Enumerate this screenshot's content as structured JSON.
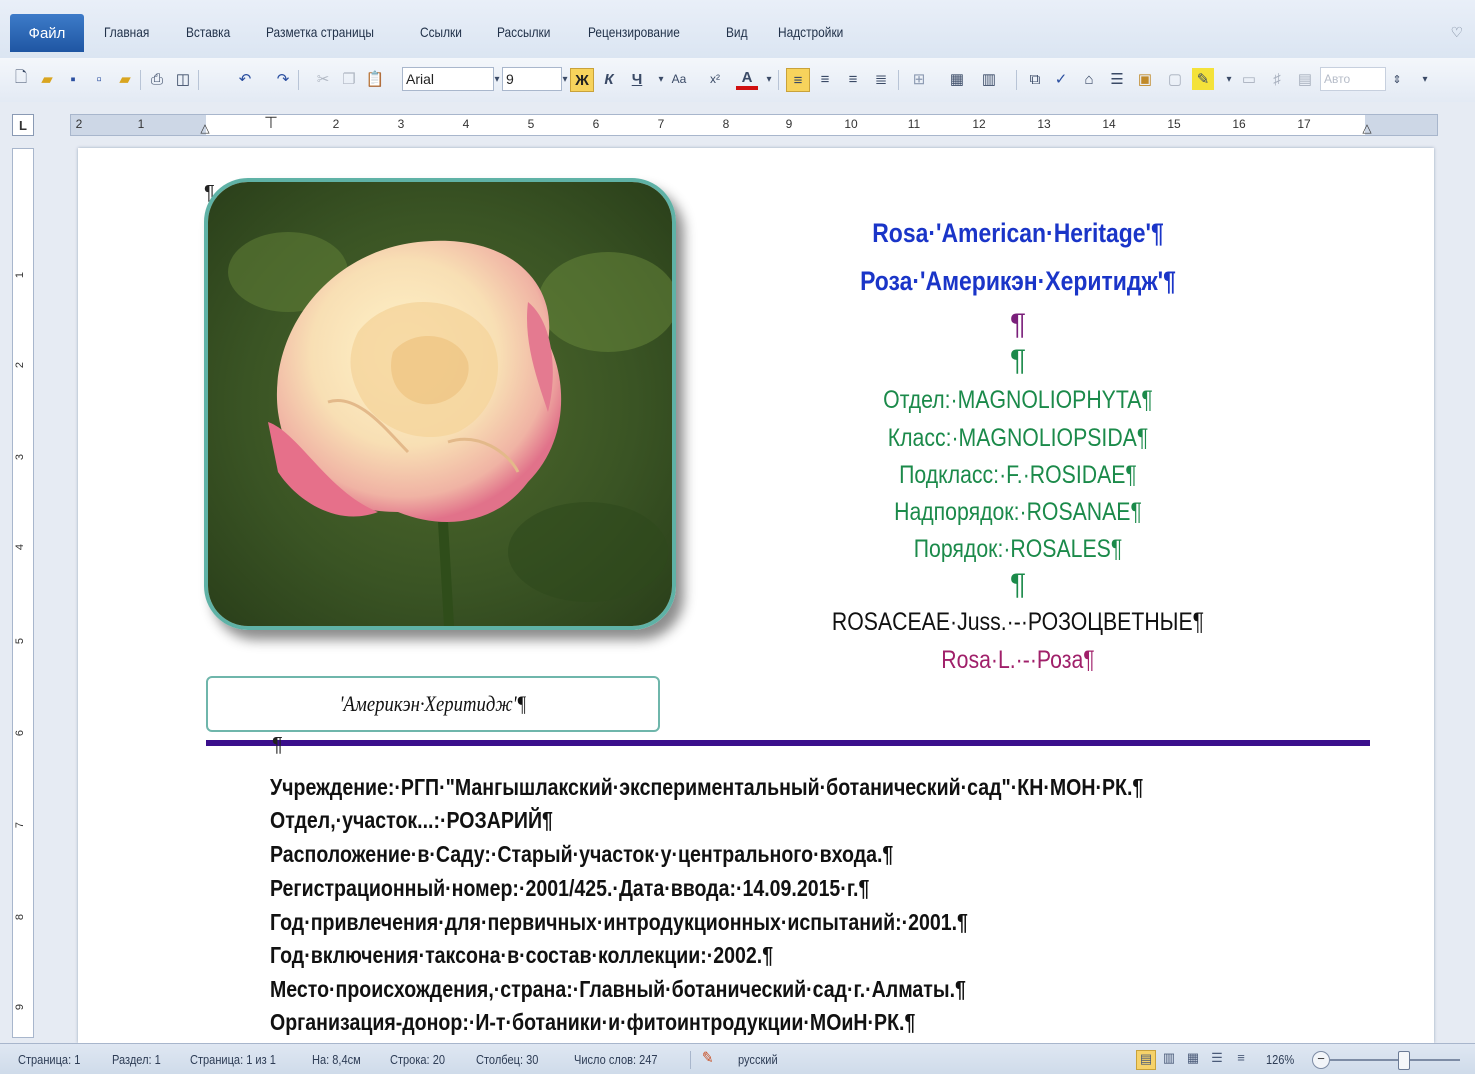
{
  "ribbon": {
    "file_tab": "Файл",
    "tabs": [
      "Главная",
      "Вставка",
      "Разметка страницы",
      "Ссылки",
      "Рассылки",
      "Рецензирование",
      "Вид",
      "Надстройки"
    ]
  },
  "toolbar": {
    "font_name": "Arial",
    "font_size": "9",
    "bold": "Ж",
    "italic": "К",
    "underline": "Ч",
    "font_color_letter": "A",
    "color_box": "Авто"
  },
  "ruler": {
    "horizontal": [
      "2",
      "1",
      "1",
      "2",
      "3",
      "4",
      "5",
      "6",
      "7",
      "8",
      "9",
      "10",
      "11",
      "12",
      "13",
      "14",
      "15",
      "16",
      "17"
    ],
    "vertical": [
      "1",
      "2",
      "3",
      "4",
      "5",
      "6",
      "7",
      "8",
      "9"
    ],
    "corner": "L"
  },
  "document": {
    "title_latin": "Rosa·'American·Heritage'¶",
    "title_russian": "Роза·'Америкэн·Херитидж'¶",
    "empty_mark_1": "¶",
    "empty_mark_2": "¶",
    "taxonomy": [
      "Отдел:·MAGNOLIOPHYTA¶",
      "Класс:·MAGNOLIOPSIDA¶",
      "Подкласс:·F.·ROSIDAE¶",
      "Надпорядок:·ROSANAE¶",
      "Порядок:·ROSALES¶"
    ],
    "empty_mark_3": "¶",
    "family": "ROSACEAE·Juss.·-·РОЗОЦВЕТНЫЕ¶",
    "genus": "Rosa·L.·-·Роза¶",
    "caption": "'Америкэн·Херитидж'¶",
    "anchor_mark_top": "¶",
    "anchor_mark_line": "¶",
    "info_lines": [
      "Учреждение:·РГП·\"Мангышлакский·экспериментальный·ботанический·сад\"·КН·МОН·РК.¶",
      "Отдел,·участок...:·РОЗАРИЙ¶",
      "Расположение·в·Саду:·Старый·участок·у·центрального·входа.¶",
      "Регистрационный·номер:·2001/425.·Дата·ввода:·14.09.2015·г.¶",
      "Год·привлечения·для·первичных·интродукционных·испытаний:·2001.¶",
      "Год·включения·таксона·в·состав·коллекции:·2002.¶",
      "Место·происхождения,·страна:·Главный·ботанический·сад·г.·Алматы.¶",
      "Организация-донор:·И-т·ботаники·и·фитоинтродукции·МОиН·РК.¶"
    ]
  },
  "statusbar": {
    "page": "Страница: 1",
    "section": "Раздел: 1",
    "pages": "Страница: 1 из 1",
    "at": "На: 8,4см",
    "line": "Строка: 20",
    "column": "Столбец: 30",
    "words": "Число слов: 247",
    "language": "русский",
    "zoom": "126%"
  },
  "colors": {
    "title": "#1a35c8",
    "taxonomy": "#1b8a4a",
    "genus": "#a0206a",
    "rule": "#3b0f8c",
    "photo_border": "#5fb2a6"
  }
}
